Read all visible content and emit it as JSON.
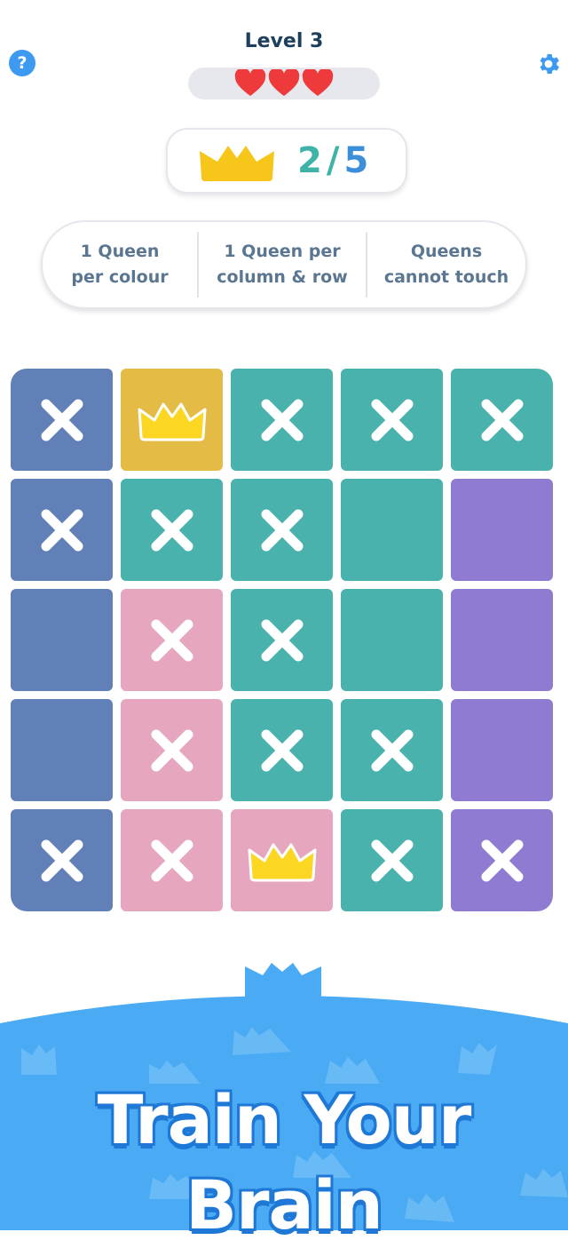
{
  "header": {
    "help_label": "?",
    "help_icon": "question-mark-icon",
    "settings_icon": "gear-icon",
    "title": "Level 3",
    "lives": {
      "total": 3,
      "remaining": 3,
      "icon": "heart-icon",
      "color": "#ee3a3a"
    }
  },
  "score": {
    "icon": "crown-icon",
    "placed": "2",
    "separator": "/",
    "total": "5",
    "colors": {
      "crown": "#f7c61b",
      "placed": "#3fb3a8",
      "total": "#3d8ed9"
    }
  },
  "rules": [
    {
      "line1": "1 Queen",
      "line2": "per colour"
    },
    {
      "line1": "1 Queen per",
      "line2": "column & row"
    },
    {
      "line1": "Queens",
      "line2": "cannot touch"
    }
  ],
  "board": {
    "size": 5,
    "palette": {
      "blue": "#6280b8",
      "gold": "#e4bc45",
      "teal": "#4ab2ad",
      "purple": "#907bd2",
      "pink": "#e6a6c0"
    },
    "rows": [
      [
        {
          "color": "blue",
          "mark": "x"
        },
        {
          "color": "gold",
          "mark": "queen"
        },
        {
          "color": "teal",
          "mark": "x"
        },
        {
          "color": "teal",
          "mark": "x"
        },
        {
          "color": "teal",
          "mark": "x"
        }
      ],
      [
        {
          "color": "blue",
          "mark": "x"
        },
        {
          "color": "teal",
          "mark": "x"
        },
        {
          "color": "teal",
          "mark": "x"
        },
        {
          "color": "teal",
          "mark": "none"
        },
        {
          "color": "purple",
          "mark": "none"
        }
      ],
      [
        {
          "color": "blue",
          "mark": "none"
        },
        {
          "color": "pink",
          "mark": "x"
        },
        {
          "color": "teal",
          "mark": "x"
        },
        {
          "color": "teal",
          "mark": "none"
        },
        {
          "color": "purple",
          "mark": "none"
        }
      ],
      [
        {
          "color": "blue",
          "mark": "none"
        },
        {
          "color": "pink",
          "mark": "x"
        },
        {
          "color": "teal",
          "mark": "x"
        },
        {
          "color": "teal",
          "mark": "x"
        },
        {
          "color": "purple",
          "mark": "none"
        }
      ],
      [
        {
          "color": "blue",
          "mark": "x"
        },
        {
          "color": "pink",
          "mark": "x"
        },
        {
          "color": "pink",
          "mark": "queen"
        },
        {
          "color": "teal",
          "mark": "x"
        },
        {
          "color": "purple",
          "mark": "x"
        }
      ]
    ]
  },
  "promo": {
    "title": "Train Your Brain",
    "background": "#4aaaf3"
  }
}
